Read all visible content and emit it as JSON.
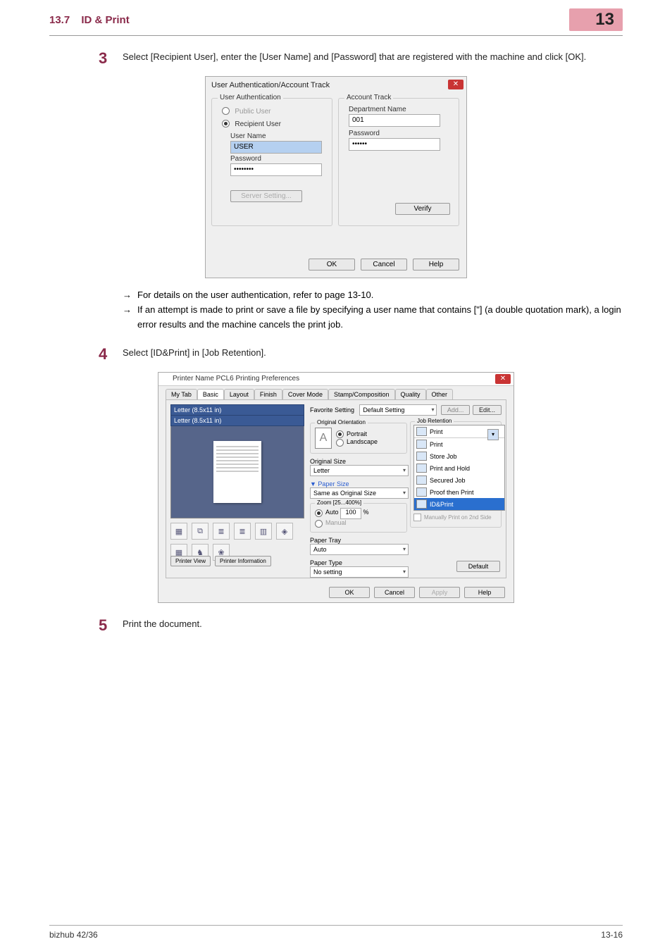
{
  "header": {
    "section_no": "13.7",
    "section_title": "ID & Print",
    "chapter_no": "13"
  },
  "steps": {
    "3": {
      "num": "3",
      "text": "Select [Recipient User], enter the [User Name] and [Password] that are registered with the machine and click [OK]."
    },
    "4": {
      "num": "4",
      "text": "Select [ID&Print] in [Job Retention]."
    },
    "5": {
      "num": "5",
      "text": "Print the document."
    }
  },
  "bullets": {
    "b1": "For details on the user authentication, refer to page 13-10.",
    "b2": "If an attempt is made to print or save a file by specifying a user name that contains [\"] (a double quotation mark), a login error results and the machine cancels the print job."
  },
  "dlg1": {
    "title": "User Authentication/Account Track",
    "g1_legend": "User Authentication",
    "g2_legend": "Account Track",
    "r_public": "Public User",
    "r_recipient": "Recipient User",
    "l_username": "User Name",
    "v_username": "USER",
    "l_password": "Password",
    "v_password": "••••••••",
    "btn_server": "Server Setting...",
    "l_dept": "Department Name",
    "v_dept": "001",
    "l_apass": "Password",
    "v_apass": "••••••",
    "btn_verify": "Verify",
    "btn_ok": "OK",
    "btn_cancel": "Cancel",
    "btn_help": "Help"
  },
  "dlg2": {
    "title": "Printer Name PCL6 Printing Preferences",
    "tabs": [
      "My Tab",
      "Basic",
      "Layout",
      "Finish",
      "Cover Mode",
      "Stamp/Composition",
      "Quality",
      "Other"
    ],
    "fav_label": "Favorite Setting",
    "fav_value": "Default Setting",
    "btn_add": "Add...",
    "btn_edit": "Edit...",
    "preview_size1": "Letter (8.5x11 in)",
    "preview_size2": "Letter (8.5x11 in)",
    "btn_pview": "Printer View",
    "btn_pinfo": "Printer Information",
    "orient_legend": "Original Orientation",
    "r_portrait": "Portrait",
    "r_landscape": "Landscape",
    "l_origsize": "Original Size",
    "v_origsize": "Letter",
    "l_papersize": "Paper Size",
    "v_papersize": "Same as Original Size",
    "zoom_legend": "Zoom [25...400%]",
    "r_auto": "Auto",
    "r_manual": "Manual",
    "zoom_val": "100",
    "zoom_unit": "%",
    "l_tray": "Paper Tray",
    "v_tray": "Auto",
    "l_ptype": "Paper Type",
    "v_ptype": "No setting",
    "jr_legend": "Job Retention",
    "dd": {
      "selected": "Print",
      "items": [
        "Print",
        "Store Job",
        "Print and Hold",
        "Secured Job",
        "Proof then Print",
        "ID&Print"
      ]
    },
    "chk_manual2": "Manually Print on 2nd Side",
    "btn_default": "Default",
    "btn_ok": "OK",
    "btn_cancel": "Cancel",
    "btn_apply": "Apply",
    "btn_help": "Help"
  },
  "footer": {
    "left": "bizhub 42/36",
    "right": "13-16"
  }
}
